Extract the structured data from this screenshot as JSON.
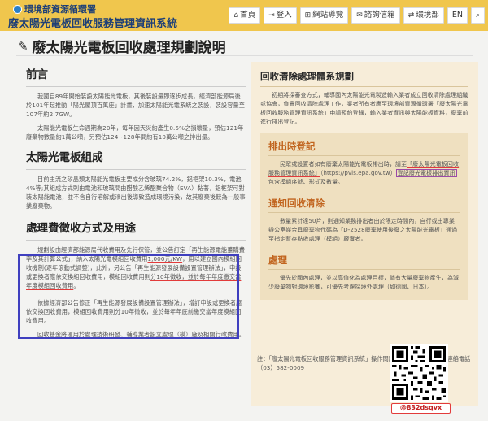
{
  "header": {
    "agency": "環境部資源循環署",
    "system_name": "廢太陽光電板回收服務管理資訊系統",
    "nav": [
      {
        "icon": "home-icon",
        "glyph": "⌂",
        "label": "首頁"
      },
      {
        "icon": "login-icon",
        "glyph": "⇥",
        "label": "登入"
      },
      {
        "icon": "sitemap-icon",
        "glyph": "⊞",
        "label": "網站導覽"
      },
      {
        "icon": "chat-icon",
        "glyph": "✉",
        "label": "諮詢信箱"
      },
      {
        "icon": "link-icon",
        "glyph": "⇄",
        "label": "環境部"
      },
      {
        "icon": "",
        "glyph": "",
        "label": "EN"
      },
      {
        "icon": "search-icon",
        "glyph": "⌕",
        "label": ""
      }
    ]
  },
  "page": {
    "title": "廢太陽光電板回收處理規劃說明"
  },
  "left": {
    "preface_heading": "前言",
    "preface_p1": "我國自89年開始裝設太陽能光電板，其後裝設量即逐步成長，經濟部能源局後於101年起推動「陽光屋頂百萬座」計畫，加速太陽能光電系統之裝設，裝設容量至107年約2.7GW。",
    "preface_p2": "太陽能光電板生命週期為20年，每年因天災約產生0.5%之損壞量，預估121年廢棄物數量約1萬公噸，另預估124~128年間約有10萬公噸之排出量。",
    "composition_heading": "太陽光電板組成",
    "composition_p": "目前主流之矽晶類太陽能光電板主要成分含玻璃74.2%，鋁框架10.3%，電池4%等;其組成方式則由電池和玻璃間由醋酸乙烯酯聚合物（EVA）黏著，鋁框架可對裝太陽能電池，並不含自行溶解或滲出後導致造成環境污染，故其廢棄後較為一般事業廢棄物。",
    "fee_heading": "處理費徵收方式及用途",
    "fee_p_before": "規劃設由經濟部能源局代收費用及先行保管，並公告訂定「再生能源電能躉購費率及其計算公式」，納入太陽光電模組回收費用",
    "fee_amount": "1,000元/KW",
    "fee_p_middle": "，用以建立國內模組回收機制(逐年滾動式調整)，此外，另公告「再生能源發展設備設置管理辦法」，申設或更換者應依交換組回收費用，模組回收費用則",
    "fee_p_underline": "分10年徵收，並於每年年度繳交當年度模組回收費用",
    "fee_p_end": "。",
    "after_p1": "依據經濟部公告修正「再生能源發展設備設置管理辦法」，增訂申設或更換者應依交換回收費用，模組回收費用則分10年徵收，並於每年年底前繳交當年度模組回收費用。",
    "after_p2": "回收基金將運用於處理技術研發、輔導業者設立處理（模）廠及相關行政費用。"
  },
  "right": {
    "heading": "回收清除處理體系規劃",
    "intro": "初期將採審查方式，輔導國內太陽能光電製造輸入業者成立回收清除處理組織或協會，負責回收清除處理工作，業者所有者應至環境部資源循環署「廢太陽光電板回收服務管理資訊系統」申請預約登錄，輸入業者資訊與太陽能板資料，廢棄前進行排出登記。",
    "reg_heading": "排出時登記",
    "reg_p1": "民眾或設置者如有廢棄太陽能光電板排出時，請至",
    "reg_system": "「廢太陽光電板回收服務管理資訊系統」",
    "reg_url": "（https://pvis.epa.gov.tw）",
    "reg_link_label": "登記廢光電板排出資訊",
    "reg_p2": "包含模組序號、形式及數量。",
    "notify_heading": "通知回收清除",
    "notify_p": "數量累計達50片，則通知業務排出者由於限定時間內，自行或由專業辦公室媒合具廢棄物代碼為「D-2528廢棄使用後廢之太陽能光電板」通過至指定暫存點收處理（模組）廠實者。",
    "proc_heading": "處理",
    "proc_p": "優先於國內處理，並以高值化為處理目標，倘有大量廢棄物產生，為減少廢棄物對環境影響，可優先考慮採境外處理（如德國、日本）。"
  },
  "footer": {
    "note": "註：「廢太陽光電板回收服務管理資訊系統」操作問題，可撥打專案辦公室連絡電話（03）582-0009",
    "qr_handle": "@832dsqvx"
  }
}
